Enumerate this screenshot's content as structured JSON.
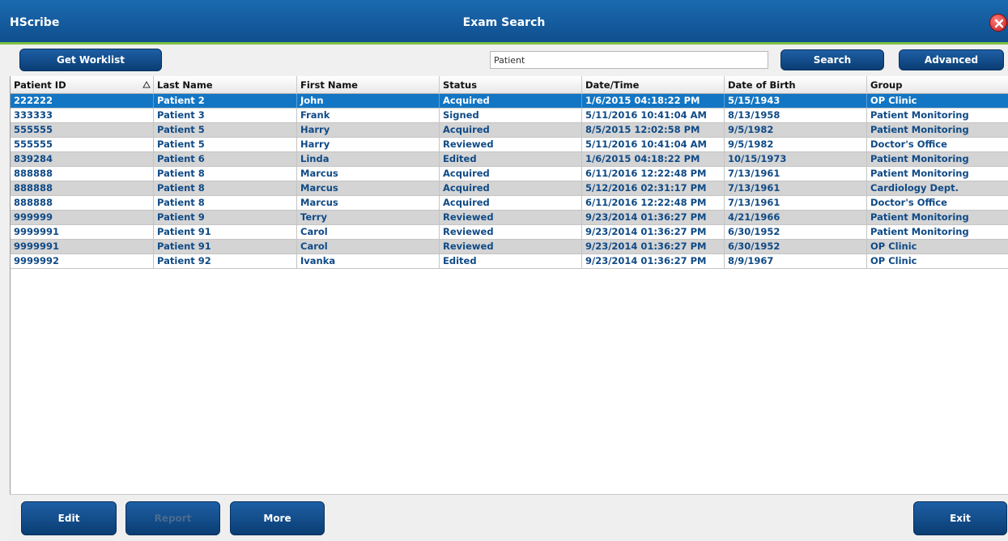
{
  "titlebar": {
    "app_name": "HScribe",
    "window_title": "Exam Search"
  },
  "toolbar": {
    "get_worklist_label": "Get Worklist",
    "search_value": "Patient",
    "search_label": "Search",
    "advanced_label": "Advanced"
  },
  "table": {
    "columns": [
      "Patient ID",
      "Last Name",
      "First Name",
      "Status",
      "Date/Time",
      "Date of Birth",
      "Group"
    ],
    "sort_column": "Patient ID",
    "sort_direction": "ascending",
    "selected_row": 0,
    "rows": [
      [
        "222222",
        "Patient 2",
        "John",
        "Acquired",
        "1/6/2015 04:18:22 PM",
        "5/15/1943",
        "OP Clinic"
      ],
      [
        "333333",
        "Patient 3",
        "Frank",
        "Signed",
        "5/11/2016 10:41:04 AM",
        "8/13/1958",
        "Patient Monitoring"
      ],
      [
        "555555",
        "Patient 5",
        "Harry",
        "Acquired",
        "8/5/2015 12:02:58 PM",
        "9/5/1982",
        "Patient Monitoring"
      ],
      [
        "555555",
        "Patient 5",
        "Harry",
        "Reviewed",
        "5/11/2016 10:41:04 AM",
        "9/5/1982",
        "Doctor's Office"
      ],
      [
        "839284",
        "Patient 6",
        "Linda",
        "Edited",
        "1/6/2015 04:18:22 PM",
        "10/15/1973",
        "Patient Monitoring"
      ],
      [
        "888888",
        "Patient 8",
        "Marcus",
        "Acquired",
        "6/11/2016 12:22:48 PM",
        "7/13/1961",
        "Patient Monitoring"
      ],
      [
        "888888",
        "Patient 8",
        "Marcus",
        "Acquired",
        "5/12/2016 02:31:17 PM",
        "7/13/1961",
        "Cardiology Dept."
      ],
      [
        "888888",
        "Patient 8",
        "Marcus",
        "Acquired",
        "6/11/2016 12:22:48 PM",
        "7/13/1961",
        "Doctor's Office"
      ],
      [
        "999999",
        "Patient 9",
        "Terry",
        "Reviewed",
        "9/23/2014 01:36:27 PM",
        "4/21/1966",
        "Patient Monitoring"
      ],
      [
        "9999991",
        "Patient 91",
        "Carol",
        "Reviewed",
        "9/23/2014 01:36:27 PM",
        "6/30/1952",
        "Patient Monitoring"
      ],
      [
        "9999991",
        "Patient 91",
        "Carol",
        "Reviewed",
        "9/23/2014 01:36:27 PM",
        "6/30/1952",
        "OP Clinic"
      ],
      [
        "9999992",
        "Patient 92",
        "Ivanka",
        "Edited",
        "9/23/2014 01:36:27 PM",
        "8/9/1967",
        "OP Clinic"
      ]
    ]
  },
  "footer": {
    "edit_label": "Edit",
    "report_label": "Report",
    "more_label": "More",
    "exit_label": "Exit"
  },
  "colors": {
    "titlebar": "#1160a8",
    "accent": "#7dc242",
    "selected_row": "#1276c4",
    "row_text": "#0f4a86",
    "alt_row": "#d4d4d4"
  },
  "icons": {
    "close": "close-icon",
    "sort": "sort-ascending-icon"
  }
}
